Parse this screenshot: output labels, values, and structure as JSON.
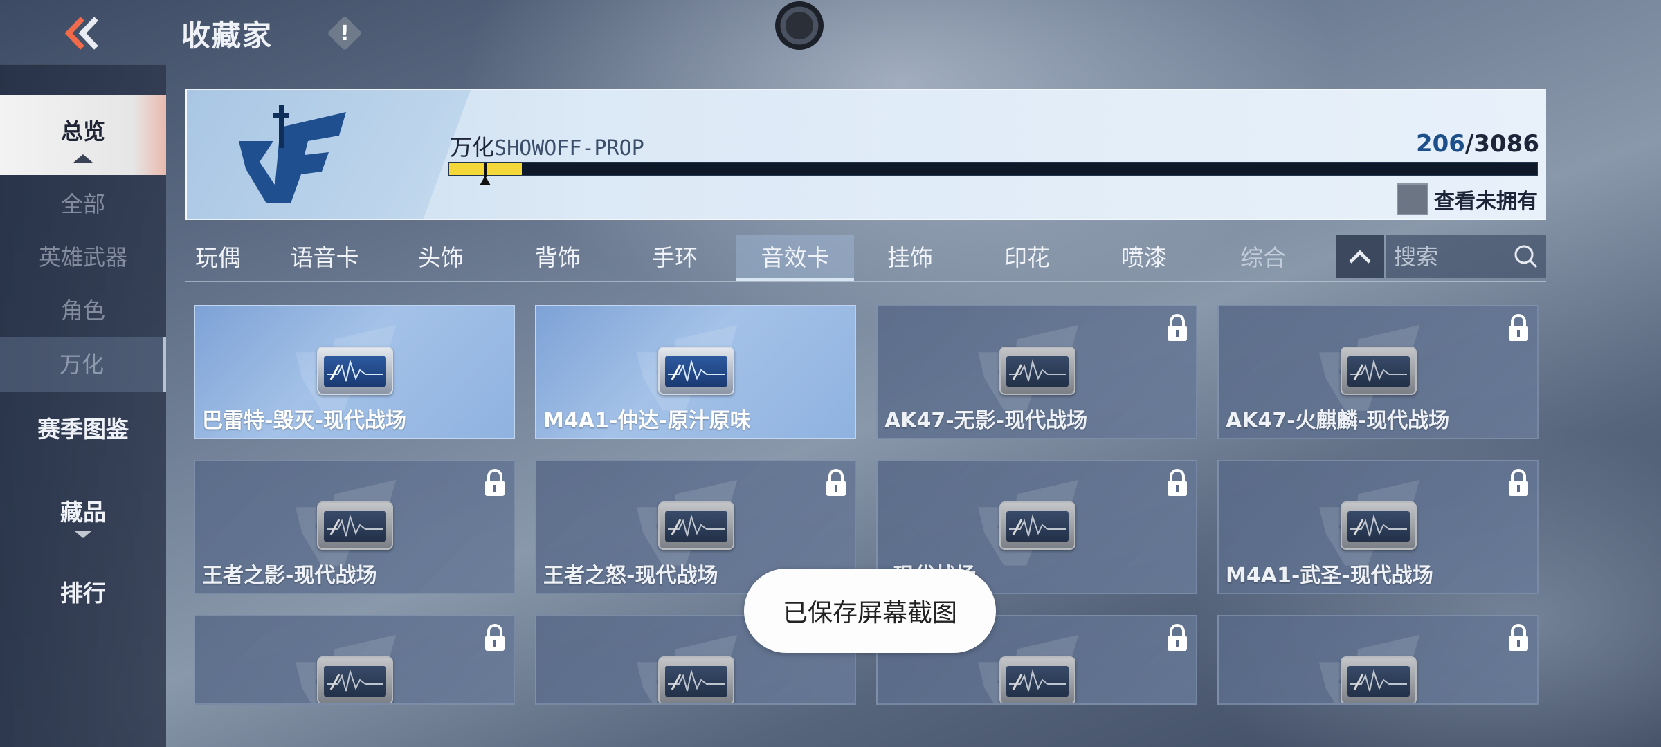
{
  "header": {
    "title": "收藏家",
    "info_mark": "!"
  },
  "sidebar": {
    "items": [
      {
        "label": "总览"
      },
      {
        "label": "全部"
      },
      {
        "label": "英雄武器"
      },
      {
        "label": "角色"
      },
      {
        "label": "万化"
      },
      {
        "label": "赛季图鉴"
      },
      {
        "label": "藏品"
      },
      {
        "label": "排行"
      }
    ]
  },
  "banner": {
    "logo_text": "CF",
    "name": "万化",
    "sub_name": "SHOWOFF-PROP",
    "owned": "206",
    "total": "/3086",
    "progress": 0.067,
    "view_unowned": "查看未拥有"
  },
  "tabs": {
    "items": [
      {
        "label": "玩偶"
      },
      {
        "label": "语音卡"
      },
      {
        "label": "头饰"
      },
      {
        "label": "背饰"
      },
      {
        "label": "手环"
      },
      {
        "label": "音效卡"
      },
      {
        "label": "挂饰"
      },
      {
        "label": "印花"
      },
      {
        "label": "喷漆"
      },
      {
        "label": "综合"
      }
    ],
    "active": "音效卡",
    "search_placeholder": "搜索"
  },
  "cards": [
    {
      "label": "巴雷特-毁灭-现代战场",
      "owned": true
    },
    {
      "label": "M4A1-仲达-原汁原味",
      "owned": true
    },
    {
      "label": "AK47-无影-现代战场",
      "owned": false
    },
    {
      "label": "AK47-火麒麟-现代战场",
      "owned": false
    },
    {
      "label": "王者之影-现代战场",
      "owned": false
    },
    {
      "label": "王者之怒-现代战场",
      "owned": false
    },
    {
      "label": "-现代战场",
      "owned": false
    },
    {
      "label": "M4A1-武圣-现代战场",
      "owned": false
    },
    {
      "label": "",
      "owned": false
    },
    {
      "label": "",
      "owned": false
    },
    {
      "label": "",
      "owned": false
    },
    {
      "label": "",
      "owned": false
    }
  ],
  "toast": {
    "message": "已保存屏幕截图"
  },
  "colors": {
    "progress_fill": "#f4d83a",
    "owned_card": "#8fb2e0",
    "locked_card": "#5a6a88",
    "sidebar_active": "#f3f3f3"
  }
}
